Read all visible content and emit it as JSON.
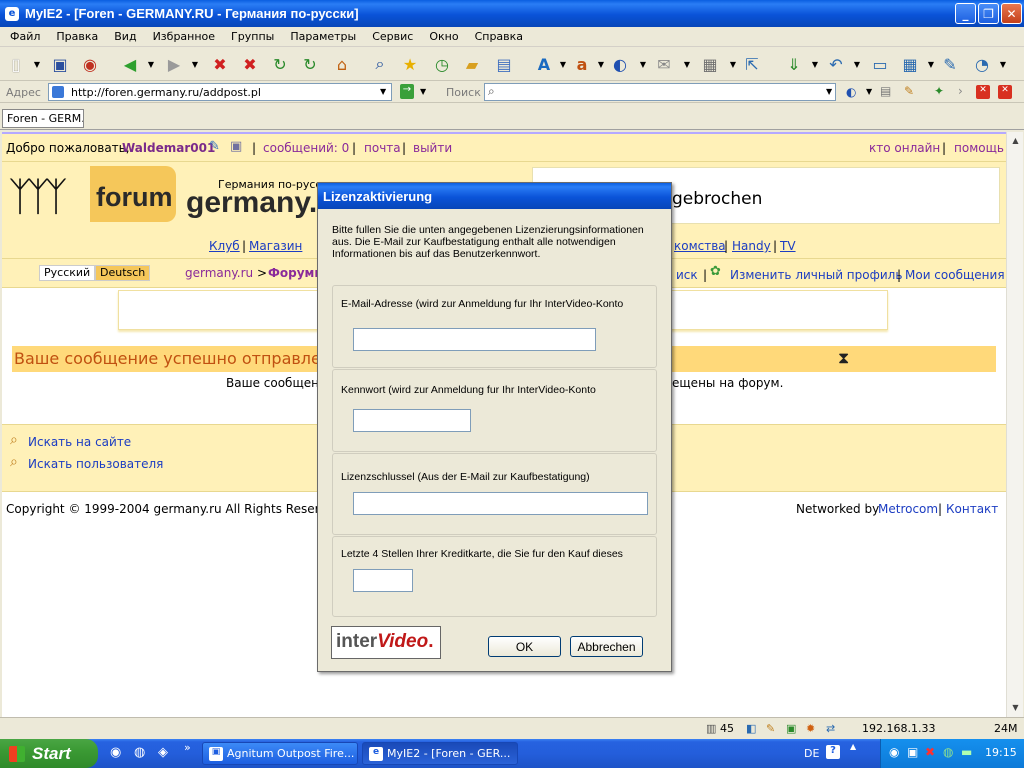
{
  "window": {
    "title": "MyIE2 - [Foren - GERMANY.RU - Германия по-русски]",
    "minimize": "_",
    "maximize": "❐",
    "close": "✕"
  },
  "menu": [
    "Файл",
    "Правка",
    "Вид",
    "Избранное",
    "Группы",
    "Параметры",
    "Сервис",
    "Окно",
    "Справка"
  ],
  "address": {
    "label": "Адрес",
    "url": "http://foren.germany.ru/addpost.pl",
    "search_label": "Поиск"
  },
  "tab": {
    "label": "Foren - GERM..."
  },
  "site": {
    "welcome": "Добро пожаловать,",
    "username": "Waldemar001",
    "messages": "сообщений: 0",
    "mail": "почта",
    "logout": "выйти",
    "who_online": "кто онлайн",
    "help": "помощь",
    "sep": "|",
    "logo_forum": "forum",
    "logo_germany": "germany.ru",
    "logo_tagline": "Германия по-русски",
    "banner_text": "gebrochen",
    "nav_left": [
      "Клуб",
      "Магазин"
    ],
    "nav_right": [
      "комства",
      "Handy",
      "TV"
    ],
    "lang_ru": "Русский",
    "lang_de": "Deutsch",
    "crumb_home": "germany.ru",
    "crumb_arrow": ">",
    "crumb_forums": "Форумы",
    "search_link": "иск",
    "profile_link": "Изменить личный профиль",
    "my_messages": "Мои сообщения",
    "success_title": "Ваше сообщение успешно отправле",
    "success_text_left": "Ваше сообщен",
    "success_text_right": "ещены на форум.",
    "search_site": "Искать на сайте",
    "search_user": "Искать пользователя",
    "copyright": "Copyright © 1999-2004 germany.ru All Rights Reserved.",
    "networked": "Networked by",
    "metrocom": "Metrocom",
    "contact": "Контакт"
  },
  "dialog": {
    "title": "Lizenzaktivierung",
    "intro": "Bitte fullen Sie die unten angegebenen Lizenzierungsinformationen aus.  Die E-Mail zur Kaufbestatigung enthalt alle notwendigen Informationen bis auf das Benutzerkennwort.",
    "email_label": "E-Mail-Adresse (wird zur Anmeldung fur Ihr InterVideo-Konto",
    "password_label": "Kennwort (wird zur Anmeldung fur Ihr InterVideo-Konto",
    "key_label": "Lizenzschlussel (Aus der E-Mail zur Kaufbestatigung)",
    "card_label": "Letzte 4 Stellen Ihrer Kreditkarte, die Sie fur den Kauf dieses",
    "email_value": "",
    "password_value": "",
    "key_value": "",
    "card_value": "",
    "logo_inter": "inter",
    "logo_video": "Video",
    "logo_dot": ".",
    "ok": "OK",
    "cancel": "Abbrechen"
  },
  "statusbar": {
    "count": "45",
    "ip": "192.168.1.33",
    "mem": "24M"
  },
  "taskbar": {
    "start": "Start",
    "quicklaunch_more": "»",
    "task1": "Agnitum Outpost Fire...",
    "task2": "MyIE2 - [Foren - GER...",
    "lang": "DE",
    "time": "19:15"
  }
}
